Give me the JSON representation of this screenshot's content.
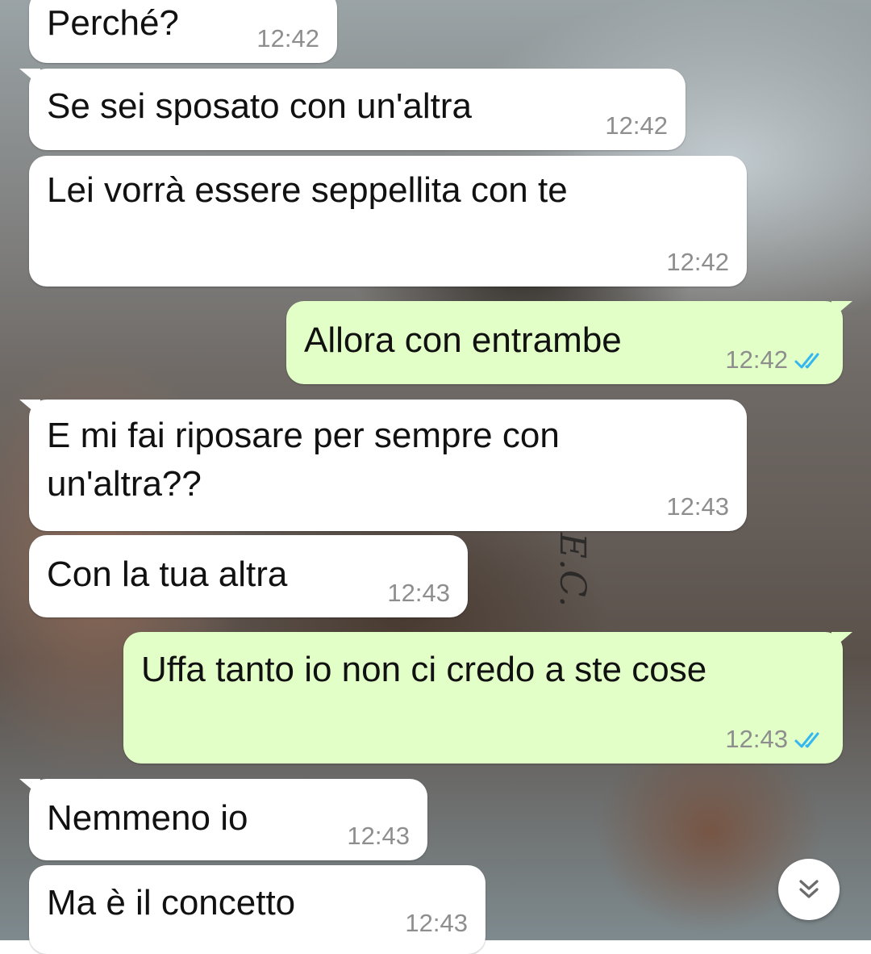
{
  "chat": {
    "messages": [
      {
        "direction": "in",
        "text": "Perché?",
        "time": "12:42"
      },
      {
        "direction": "in",
        "text": "Se sei sposato con un'altra",
        "time": "12:42"
      },
      {
        "direction": "in",
        "text": "Lei vorrà essere seppellita con te",
        "time": "12:42"
      },
      {
        "direction": "out",
        "text": "Allora con entrambe",
        "time": "12:42",
        "status": "read"
      },
      {
        "direction": "in",
        "text_line1": "E mi fai riposare per sempre con",
        "text_line2": "un'altra??",
        "time": "12:43"
      },
      {
        "direction": "in",
        "text": "Con la tua altra",
        "time": "12:43"
      },
      {
        "direction": "out",
        "text": "Uffa tanto io non ci credo a ste cose",
        "time": "12:43",
        "status": "read"
      },
      {
        "direction": "in",
        "text": "Nemmeno io",
        "time": "12:43"
      },
      {
        "direction": "in",
        "text": "Ma è il concetto",
        "time": "12:43"
      }
    ]
  },
  "wallpaper": {
    "tattoo_text": "E.C."
  },
  "colors": {
    "incoming_bubble": "#ffffff",
    "outgoing_bubble": "#e2ffc7",
    "timestamp": "#8e8e8e",
    "read_ticks": "#34b7f1"
  },
  "icons": {
    "read_receipt": "double-check-icon",
    "scroll_down": "chevron-double-down-icon"
  }
}
